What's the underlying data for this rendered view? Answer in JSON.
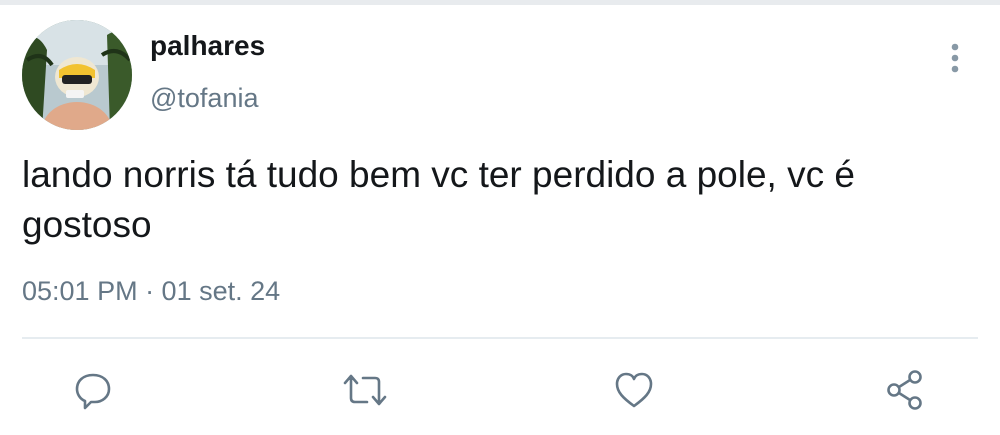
{
  "tweet": {
    "display_name": "palhares",
    "handle": "@tofania",
    "text": "lando norris tá tudo bem vc ter perdido a pole, vc é gostoso",
    "timestamp": "05:01 PM · 01 set. 24"
  },
  "icons": {
    "more": "more-vertical-icon",
    "reply": "reply-icon",
    "retweet": "retweet-icon",
    "like": "heart-icon",
    "share": "share-icon"
  },
  "colors": {
    "text": "#14171a",
    "secondary": "#657786",
    "icon": "#657786",
    "divider": "#e6ecf0"
  }
}
